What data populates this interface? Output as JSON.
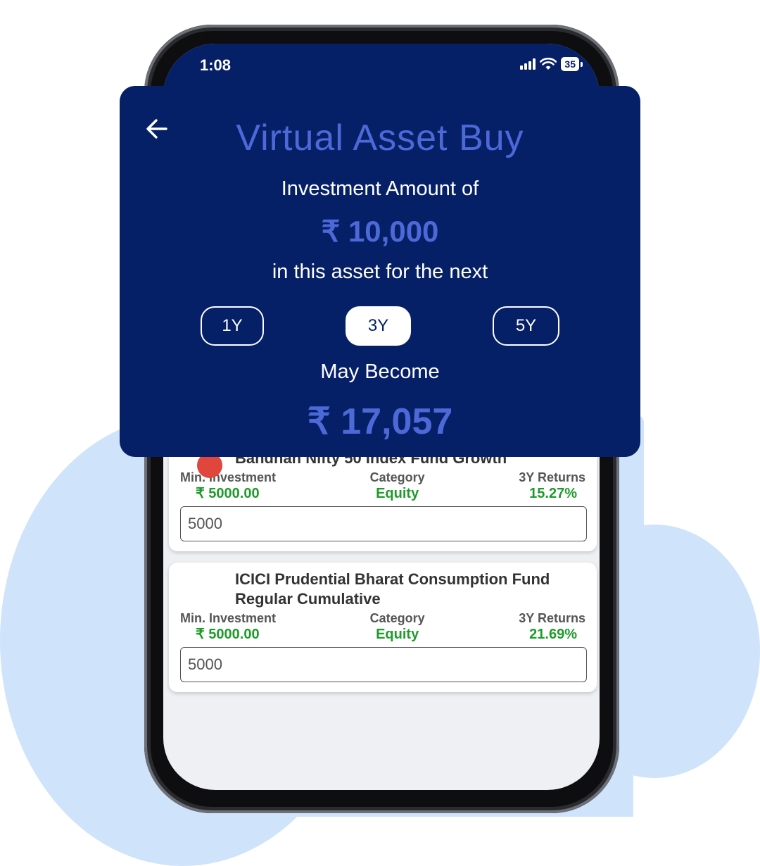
{
  "status_bar": {
    "time": "1:08",
    "battery": "35"
  },
  "overlay": {
    "title": "Virtual Asset Buy",
    "line1": "Investment Amount of",
    "amount": "₹ 10,000",
    "line2": "in this asset for the next",
    "periods": [
      {
        "label": "1Y",
        "selected": false
      },
      {
        "label": "3Y",
        "selected": true
      },
      {
        "label": "5Y",
        "selected": false
      }
    ],
    "line3": "May Become",
    "result": "₹ 17,057"
  },
  "funds": [
    {
      "name": "Bandhan Nifty 50 Index Fund Growth",
      "min_investment_label": "Min. Investment",
      "min_investment": "₹ 5000.00",
      "category_label": "Category",
      "category": "Equity",
      "returns_label": "3Y Returns",
      "returns": "15.27%",
      "amount_value": "5000"
    },
    {
      "name": "ICICI Prudential Bharat Consumption Fund Regular Cumulative",
      "min_investment_label": "Min. Investment",
      "min_investment": "₹ 5000.00",
      "category_label": "Category",
      "category": "Equity",
      "returns_label": "3Y Returns",
      "returns": "21.69%",
      "amount_value": "5000"
    }
  ],
  "colors": {
    "brand_navy": "#062068",
    "accent_blue": "#4d69d8",
    "positive_green": "#1e9b2a",
    "cloud": "#cfe3fb"
  },
  "icons": {
    "back": "arrow-left-icon",
    "signal": "cellular-signal-icon",
    "wifi": "wifi-icon",
    "battery": "battery-icon"
  }
}
